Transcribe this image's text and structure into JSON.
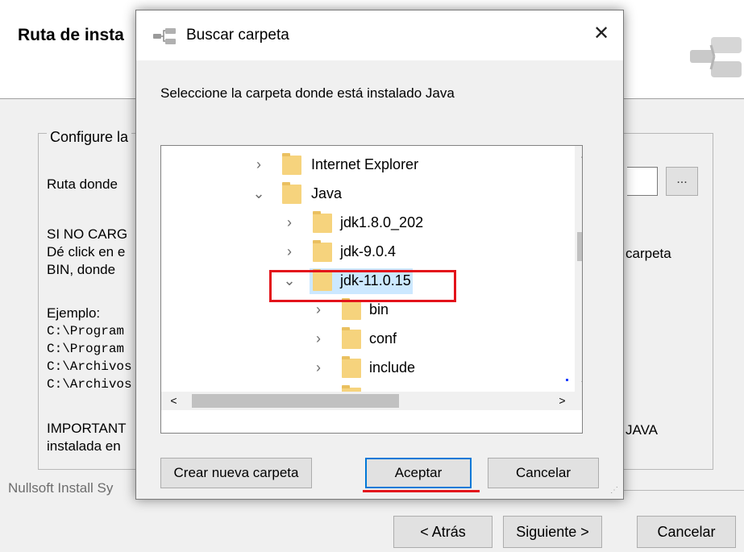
{
  "installer": {
    "header_title": "Ruta de insta",
    "group_caption": "Configure la",
    "path_label": "Ruta donde",
    "note_line1": "SI NO CARG",
    "note_line2": "Dé click en e",
    "note_line3": "BIN, donde",
    "note_right": "carpeta",
    "example_label": "Ejemplo:",
    "example_paths": [
      "C:\\Program",
      "C:\\Program",
      "C:\\Archivos",
      "C:\\Archivos"
    ],
    "important_line1": "IMPORTANT",
    "important_line2": "instalada en",
    "important_right": "JAVA",
    "browse_label": "...",
    "branding": "Nullsoft Install Sy",
    "back_button": "< Atrás",
    "next_button": "Siguiente >",
    "cancel_button": "Cancelar"
  },
  "dialog": {
    "title": "Buscar carpeta",
    "close_glyph": "✕",
    "instruction": "Seleccione la carpeta donde está instalado Java",
    "tree": [
      {
        "label": "Internet Explorer",
        "chevron": "›",
        "selected": false
      },
      {
        "label": "Java",
        "chevron": "⌄",
        "selected": false
      },
      {
        "label": "jdk1.8.0_202",
        "chevron": "›",
        "selected": false
      },
      {
        "label": "jdk-9.0.4",
        "chevron": "›",
        "selected": false
      },
      {
        "label": "jdk-11.0.15",
        "chevron": "⌄",
        "selected": true
      },
      {
        "label": "bin",
        "chevron": "›",
        "selected": false
      },
      {
        "label": "conf",
        "chevron": "›",
        "selected": false
      },
      {
        "label": "include",
        "chevron": "›",
        "selected": false
      }
    ],
    "scroll_up": "^",
    "scroll_down": "⌄",
    "scroll_left": "<",
    "scroll_right": ">",
    "new_folder_button": "Crear nueva carpeta",
    "accept_button": "Aceptar",
    "cancel_button": "Cancelar"
  },
  "colors": {
    "highlight": "#e3131b",
    "selection": "#cce8ff",
    "folder": "#f6d37d",
    "focus_border": "#0078d7"
  }
}
